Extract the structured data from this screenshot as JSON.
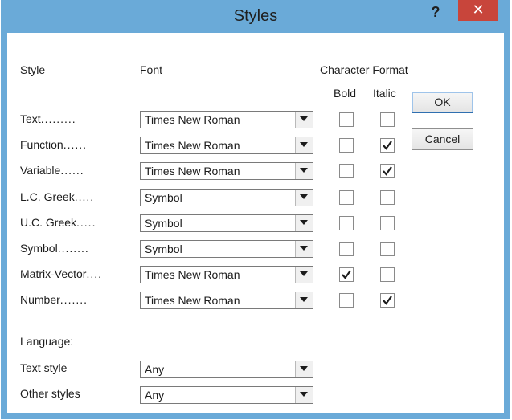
{
  "dialog": {
    "title": "Styles"
  },
  "titlebar": {
    "help_label": "?",
    "close_label": "✕"
  },
  "headers": {
    "style": "Style",
    "font": "Font",
    "character_format": "Character Format",
    "bold": "Bold",
    "italic": "Italic"
  },
  "rows": [
    {
      "style": "Text",
      "font": "Times New Roman",
      "bold": false,
      "italic": false
    },
    {
      "style": "Function",
      "font": "Times New Roman",
      "bold": false,
      "italic": true
    },
    {
      "style": "Variable",
      "font": "Times New Roman",
      "bold": false,
      "italic": true
    },
    {
      "style": "L.C. Greek",
      "font": "Symbol",
      "bold": false,
      "italic": false
    },
    {
      "style": "U.C. Greek",
      "font": "Symbol",
      "bold": false,
      "italic": false
    },
    {
      "style": "Symbol",
      "font": "Symbol",
      "bold": false,
      "italic": false
    },
    {
      "style": "Matrix-Vector",
      "font": "Times New Roman",
      "bold": true,
      "italic": false
    },
    {
      "style": "Number",
      "font": "Times New Roman",
      "bold": false,
      "italic": true
    }
  ],
  "dots": [
    ".........",
    "......",
    "......",
    ".....",
    ".....",
    "........",
    "....",
    "......."
  ],
  "buttons": {
    "ok": "OK",
    "cancel": "Cancel"
  },
  "language": {
    "label": "Language:",
    "text_style_label": "Text style",
    "text_style_value": "Any",
    "other_styles_label": "Other styles",
    "other_styles_value": "Any"
  },
  "colors": {
    "frame": "#6aaad8",
    "close": "#c8453b"
  }
}
